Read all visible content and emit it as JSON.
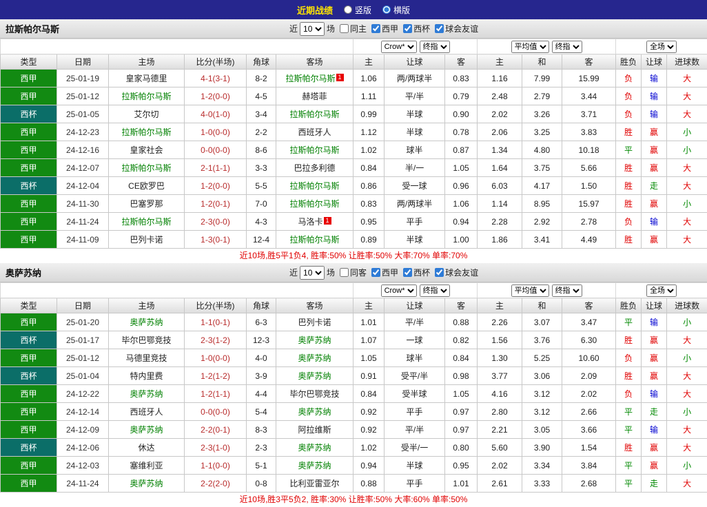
{
  "topbar": {
    "title": "近期战绩",
    "layout_options": [
      {
        "label": "竖版",
        "checked": false
      },
      {
        "label": "横版",
        "checked": true
      }
    ]
  },
  "columns": [
    "类型",
    "日期",
    "主场",
    "比分(半场)",
    "角球",
    "客场",
    "主",
    "让球",
    "客",
    "主",
    "和",
    "客",
    "胜负",
    "让球",
    "进球数"
  ],
  "colors": {
    "topbar_bg": "#26268E",
    "title_text": "#FFE400",
    "liga_badge": "#128A12",
    "cup_badge": "#0B6E68",
    "featured_team": "#008000",
    "score_text": "#B82B2B",
    "win_red": "#E00000",
    "draw_green": "#008800",
    "lose_blue": "#0000D0"
  },
  "sections": [
    {
      "team": "拉斯帕尔马斯",
      "filters": {
        "near": "近",
        "count": "10",
        "games": "场",
        "checkboxes": [
          {
            "label": "同主",
            "checked": false
          },
          {
            "label": "西甲",
            "checked": true
          },
          {
            "label": "西杯",
            "checked": true
          },
          {
            "label": "球会友谊",
            "checked": true
          }
        ]
      },
      "selects": [
        "Crow*",
        "终指",
        "平均值",
        "终指",
        "全场"
      ],
      "rows": [
        {
          "league": "西甲",
          "date": "25-01-19",
          "home": "皇家马德里",
          "home_featured": false,
          "home_card": "",
          "score": "4-1(3-1)",
          "corners": "8-2",
          "away": "拉斯帕尔马斯",
          "away_featured": true,
          "away_card": "1",
          "ah_home": "1.06",
          "ah_line": "两/两球半",
          "ah_away": "0.83",
          "eu_home": "1.16",
          "eu_draw": "7.99",
          "eu_away": "15.99",
          "res_wdl": "负",
          "res_ah": "输",
          "res_ou": "大"
        },
        {
          "league": "西甲",
          "date": "25-01-12",
          "home": "拉斯帕尔马斯",
          "home_featured": true,
          "home_card": "",
          "score": "1-2(0-0)",
          "corners": "4-5",
          "away": "赫塔菲",
          "away_featured": false,
          "away_card": "",
          "ah_home": "1.11",
          "ah_line": "平/半",
          "ah_away": "0.79",
          "eu_home": "2.48",
          "eu_draw": "2.79",
          "eu_away": "3.44",
          "res_wdl": "负",
          "res_ah": "输",
          "res_ou": "大"
        },
        {
          "league": "西杯",
          "date": "25-01-05",
          "home": "艾尔切",
          "home_featured": false,
          "home_card": "",
          "score": "4-0(1-0)",
          "corners": "3-4",
          "away": "拉斯帕尔马斯",
          "away_featured": true,
          "away_card": "",
          "ah_home": "0.99",
          "ah_line": "半球",
          "ah_away": "0.90",
          "eu_home": "2.02",
          "eu_draw": "3.26",
          "eu_away": "3.71",
          "res_wdl": "负",
          "res_ah": "输",
          "res_ou": "大"
        },
        {
          "league": "西甲",
          "date": "24-12-23",
          "home": "拉斯帕尔马斯",
          "home_featured": true,
          "home_card": "",
          "score": "1-0(0-0)",
          "corners": "2-2",
          "away": "西班牙人",
          "away_featured": false,
          "away_card": "",
          "ah_home": "1.12",
          "ah_line": "半球",
          "ah_away": "0.78",
          "eu_home": "2.06",
          "eu_draw": "3.25",
          "eu_away": "3.83",
          "res_wdl": "胜",
          "res_ah": "赢",
          "res_ou": "小"
        },
        {
          "league": "西甲",
          "date": "24-12-16",
          "home": "皇家社会",
          "home_featured": false,
          "home_card": "",
          "score": "0-0(0-0)",
          "corners": "8-6",
          "away": "拉斯帕尔马斯",
          "away_featured": true,
          "away_card": "",
          "ah_home": "1.02",
          "ah_line": "球半",
          "ah_away": "0.87",
          "eu_home": "1.34",
          "eu_draw": "4.80",
          "eu_away": "10.18",
          "res_wdl": "平",
          "res_ah": "赢",
          "res_ou": "小"
        },
        {
          "league": "西甲",
          "date": "24-12-07",
          "home": "拉斯帕尔马斯",
          "home_featured": true,
          "home_card": "",
          "score": "2-1(1-1)",
          "corners": "3-3",
          "away": "巴拉多利德",
          "away_featured": false,
          "away_card": "",
          "ah_home": "0.84",
          "ah_line": "半/一",
          "ah_away": "1.05",
          "eu_home": "1.64",
          "eu_draw": "3.75",
          "eu_away": "5.66",
          "res_wdl": "胜",
          "res_ah": "赢",
          "res_ou": "大"
        },
        {
          "league": "西杯",
          "date": "24-12-04",
          "home": "CE欧罗巴",
          "home_featured": false,
          "home_card": "",
          "score": "1-2(0-0)",
          "corners": "5-5",
          "away": "拉斯帕尔马斯",
          "away_featured": true,
          "away_card": "",
          "ah_home": "0.86",
          "ah_line": "受一球",
          "ah_away": "0.96",
          "eu_home": "6.03",
          "eu_draw": "4.17",
          "eu_away": "1.50",
          "res_wdl": "胜",
          "res_ah": "走",
          "res_ou": "大"
        },
        {
          "league": "西甲",
          "date": "24-11-30",
          "home": "巴塞罗那",
          "home_featured": false,
          "home_card": "",
          "score": "1-2(0-1)",
          "corners": "7-0",
          "away": "拉斯帕尔马斯",
          "away_featured": true,
          "away_card": "",
          "ah_home": "0.83",
          "ah_line": "两/两球半",
          "ah_away": "1.06",
          "eu_home": "1.14",
          "eu_draw": "8.95",
          "eu_away": "15.97",
          "res_wdl": "胜",
          "res_ah": "赢",
          "res_ou": "小"
        },
        {
          "league": "西甲",
          "date": "24-11-24",
          "home": "拉斯帕尔马斯",
          "home_featured": true,
          "home_card": "",
          "score": "2-3(0-0)",
          "corners": "4-3",
          "away": "马洛卡",
          "away_featured": false,
          "away_card": "1",
          "ah_home": "0.95",
          "ah_line": "平手",
          "ah_away": "0.94",
          "eu_home": "2.28",
          "eu_draw": "2.92",
          "eu_away": "2.78",
          "res_wdl": "负",
          "res_ah": "输",
          "res_ou": "大"
        },
        {
          "league": "西甲",
          "date": "24-11-09",
          "home": "巴列卡诺",
          "home_featured": false,
          "home_card": "",
          "score": "1-3(0-1)",
          "corners": "12-4",
          "away": "拉斯帕尔马斯",
          "away_featured": true,
          "away_card": "",
          "ah_home": "0.89",
          "ah_line": "半球",
          "ah_away": "1.00",
          "eu_home": "1.86",
          "eu_draw": "3.41",
          "eu_away": "4.49",
          "res_wdl": "胜",
          "res_ah": "赢",
          "res_ou": "大"
        }
      ],
      "summary": "近10场,胜5平1负4, 胜率:50% 让胜率:50% 大率:70% 单率:70%"
    },
    {
      "team": "奥萨苏纳",
      "filters": {
        "near": "近",
        "count": "10",
        "games": "场",
        "checkboxes": [
          {
            "label": "同客",
            "checked": false
          },
          {
            "label": "西甲",
            "checked": true
          },
          {
            "label": "西杯",
            "checked": true
          },
          {
            "label": "球会友谊",
            "checked": true
          }
        ]
      },
      "selects": [
        "Crow*",
        "终指",
        "平均值",
        "终指",
        "全场"
      ],
      "rows": [
        {
          "league": "西甲",
          "date": "25-01-20",
          "home": "奥萨苏纳",
          "home_featured": true,
          "home_card": "",
          "score": "1-1(0-1)",
          "corners": "6-3",
          "away": "巴列卡诺",
          "away_featured": false,
          "away_card": "",
          "ah_home": "1.01",
          "ah_line": "平/半",
          "ah_away": "0.88",
          "eu_home": "2.26",
          "eu_draw": "3.07",
          "eu_away": "3.47",
          "res_wdl": "平",
          "res_ah": "输",
          "res_ou": "小"
        },
        {
          "league": "西杯",
          "date": "25-01-17",
          "home": "毕尔巴鄂竞技",
          "home_featured": false,
          "home_card": "",
          "score": "2-3(1-2)",
          "corners": "12-3",
          "away": "奥萨苏纳",
          "away_featured": true,
          "away_card": "",
          "ah_home": "1.07",
          "ah_line": "一球",
          "ah_away": "0.82",
          "eu_home": "1.56",
          "eu_draw": "3.76",
          "eu_away": "6.30",
          "res_wdl": "胜",
          "res_ah": "赢",
          "res_ou": "大"
        },
        {
          "league": "西甲",
          "date": "25-01-12",
          "home": "马德里竞技",
          "home_featured": false,
          "home_card": "",
          "score": "1-0(0-0)",
          "corners": "4-0",
          "away": "奥萨苏纳",
          "away_featured": true,
          "away_card": "",
          "ah_home": "1.05",
          "ah_line": "球半",
          "ah_away": "0.84",
          "eu_home": "1.30",
          "eu_draw": "5.25",
          "eu_away": "10.60",
          "res_wdl": "负",
          "res_ah": "赢",
          "res_ou": "小"
        },
        {
          "league": "西杯",
          "date": "25-01-04",
          "home": "特内里费",
          "home_featured": false,
          "home_card": "",
          "score": "1-2(1-2)",
          "corners": "3-9",
          "away": "奥萨苏纳",
          "away_featured": true,
          "away_card": "",
          "ah_home": "0.91",
          "ah_line": "受平/半",
          "ah_away": "0.98",
          "eu_home": "3.77",
          "eu_draw": "3.06",
          "eu_away": "2.09",
          "res_wdl": "胜",
          "res_ah": "赢",
          "res_ou": "大"
        },
        {
          "league": "西甲",
          "date": "24-12-22",
          "home": "奥萨苏纳",
          "home_featured": true,
          "home_card": "",
          "score": "1-2(1-1)",
          "corners": "4-4",
          "away": "毕尔巴鄂竞技",
          "away_featured": false,
          "away_card": "",
          "ah_home": "0.84",
          "ah_line": "受半球",
          "ah_away": "1.05",
          "eu_home": "4.16",
          "eu_draw": "3.12",
          "eu_away": "2.02",
          "res_wdl": "负",
          "res_ah": "输",
          "res_ou": "大"
        },
        {
          "league": "西甲",
          "date": "24-12-14",
          "home": "西班牙人",
          "home_featured": false,
          "home_card": "",
          "score": "0-0(0-0)",
          "corners": "5-4",
          "away": "奥萨苏纳",
          "away_featured": true,
          "away_card": "",
          "ah_home": "0.92",
          "ah_line": "平手",
          "ah_away": "0.97",
          "eu_home": "2.80",
          "eu_draw": "3.12",
          "eu_away": "2.66",
          "res_wdl": "平",
          "res_ah": "走",
          "res_ou": "小"
        },
        {
          "league": "西甲",
          "date": "24-12-09",
          "home": "奥萨苏纳",
          "home_featured": true,
          "home_card": "",
          "score": "2-2(0-1)",
          "corners": "8-3",
          "away": "阿拉维斯",
          "away_featured": false,
          "away_card": "",
          "ah_home": "0.92",
          "ah_line": "平/半",
          "ah_away": "0.97",
          "eu_home": "2.21",
          "eu_draw": "3.05",
          "eu_away": "3.66",
          "res_wdl": "平",
          "res_ah": "输",
          "res_ou": "大"
        },
        {
          "league": "西杯",
          "date": "24-12-06",
          "home": "休达",
          "home_featured": false,
          "home_card": "",
          "score": "2-3(1-0)",
          "corners": "2-3",
          "away": "奥萨苏纳",
          "away_featured": true,
          "away_card": "",
          "ah_home": "1.02",
          "ah_line": "受半/一",
          "ah_away": "0.80",
          "eu_home": "5.60",
          "eu_draw": "3.90",
          "eu_away": "1.54",
          "res_wdl": "胜",
          "res_ah": "赢",
          "res_ou": "大"
        },
        {
          "league": "西甲",
          "date": "24-12-03",
          "home": "塞维利亚",
          "home_featured": false,
          "home_card": "",
          "score": "1-1(0-0)",
          "corners": "5-1",
          "away": "奥萨苏纳",
          "away_featured": true,
          "away_card": "",
          "ah_home": "0.94",
          "ah_line": "半球",
          "ah_away": "0.95",
          "eu_home": "2.02",
          "eu_draw": "3.34",
          "eu_away": "3.84",
          "res_wdl": "平",
          "res_ah": "赢",
          "res_ou": "小"
        },
        {
          "league": "西甲",
          "date": "24-11-24",
          "home": "奥萨苏纳",
          "home_featured": true,
          "home_card": "",
          "score": "2-2(2-0)",
          "corners": "0-8",
          "away": "比利亚雷亚尔",
          "away_featured": false,
          "away_card": "",
          "ah_home": "0.88",
          "ah_line": "平手",
          "ah_away": "1.01",
          "eu_home": "2.61",
          "eu_draw": "3.33",
          "eu_away": "2.68",
          "res_wdl": "平",
          "res_ah": "走",
          "res_ou": "大"
        }
      ],
      "summary": "近10场,胜3平5负2, 胜率:30% 让胜率:50% 大率:60% 单率:50%"
    }
  ]
}
